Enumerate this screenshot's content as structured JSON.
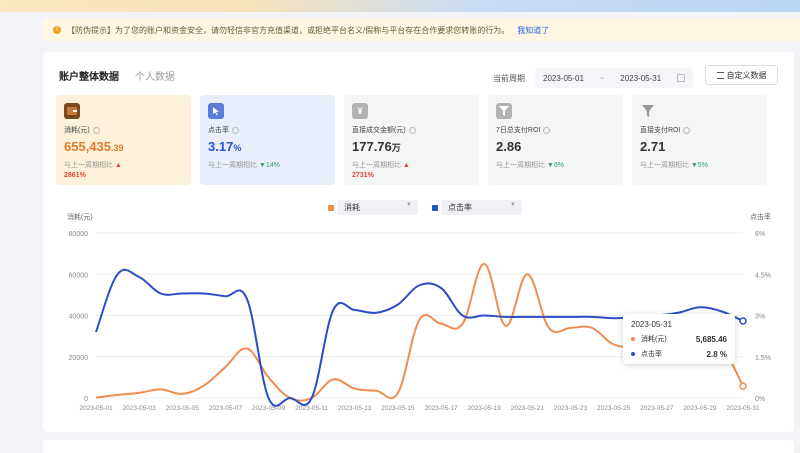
{
  "notice": {
    "text": "【防伪提示】为了您的账户和资金安全，请勿轻信非官方充值渠道，或拒绝平台名义/假称与平台存在合作要求您转账的行为。",
    "link": "我知道了"
  },
  "tabs": [
    {
      "label": "账户整体数据"
    },
    {
      "label": "个人数据"
    }
  ],
  "period": {
    "label": "当前周期",
    "start": "2023-05-01",
    "sep": "~",
    "end": "2023-05-31"
  },
  "custom_button": "自定义数据",
  "kpis": [
    {
      "label": "消耗(元)",
      "value_main": "655,435",
      "value_small": ".39",
      "compare": "与上一周期相比",
      "change": "2861%",
      "dir": "up",
      "icon": "wallet-icon",
      "color": "#e07a2e"
    },
    {
      "label": "点击率",
      "value_main": "3.17",
      "value_small": "%",
      "compare": "与上一周期相比",
      "change": "14%",
      "dir": "down",
      "icon": "click-icon",
      "color": "#2a55c8"
    },
    {
      "label": "直接成交金额(元)",
      "value_main": "177.76",
      "value_small": "万",
      "compare": "与上一周期相比",
      "change": "2731%",
      "dir": "up",
      "icon": "yen-icon",
      "color": "#888888"
    },
    {
      "label": "7日总支付ROI",
      "value_main": "2.86",
      "value_small": "",
      "compare": "与上一周期相比",
      "change": "6%",
      "dir": "down",
      "icon": "funnel-yen-icon",
      "color": "#888888"
    },
    {
      "label": "直接支付ROI",
      "value_main": "2.71",
      "value_small": "",
      "compare": "与上一周期相比",
      "change": "5%",
      "dir": "down",
      "icon": "funnel-icon",
      "color": "#888888"
    }
  ],
  "legend": {
    "s1": "消耗",
    "s2": "点击率"
  },
  "tooltip": {
    "date": "2023-05-31",
    "s1_name": "消耗(元)",
    "s1_value": "5,685.46",
    "s2_name": "点击率",
    "s2_value": "2.8 %"
  },
  "chart_data": {
    "type": "line",
    "ylabel_left": "消耗(元)",
    "ylabel_right": "点击率",
    "left_ticks": [
      "80000",
      "60000",
      "40000",
      "20000",
      "0"
    ],
    "right_ticks": [
      "6%",
      "4.5%",
      "3%",
      "1.5%",
      "0%"
    ],
    "ylim_left": [
      0,
      80000
    ],
    "ylim_right": [
      0,
      6
    ],
    "x_tick_labels": [
      "2023-05-01",
      "2023-05-03",
      "2023-05-05",
      "2023-05-07",
      "2023-05-09",
      "2023-05-11",
      "2023-05-13",
      "2023-05-15",
      "2023-05-17",
      "2023-05-19",
      "2023-05-21",
      "2023-05-23",
      "2023-05-25",
      "2023-05-27",
      "2023-05-29",
      "2023-05-31"
    ],
    "x": [
      "2023-05-01",
      "2023-05-02",
      "2023-05-03",
      "2023-05-04",
      "2023-05-05",
      "2023-05-06",
      "2023-05-07",
      "2023-05-08",
      "2023-05-09",
      "2023-05-10",
      "2023-05-11",
      "2023-05-12",
      "2023-05-13",
      "2023-05-14",
      "2023-05-15",
      "2023-05-16",
      "2023-05-17",
      "2023-05-18",
      "2023-05-19",
      "2023-05-20",
      "2023-05-21",
      "2023-05-22",
      "2023-05-23",
      "2023-05-24",
      "2023-05-25",
      "2023-05-26",
      "2023-05-27",
      "2023-05-28",
      "2023-05-29",
      "2023-05-30",
      "2023-05-31"
    ],
    "series": [
      {
        "name": "消耗",
        "axis": "left",
        "color": "#ef8c4f",
        "values": [
          200,
          1500,
          2500,
          4200,
          2000,
          6000,
          15000,
          24000,
          10000,
          0,
          0,
          9000,
          4500,
          3500,
          2500,
          38000,
          36000,
          36000,
          65000,
          35000,
          60000,
          34000,
          34000,
          34000,
          26000,
          26000,
          36000,
          36000,
          36000,
          26000,
          5700
        ]
      },
      {
        "name": "点击率",
        "axis": "right",
        "color": "#2a4fc4",
        "values": [
          2.4,
          4.5,
          4.4,
          3.8,
          3.8,
          3.8,
          3.7,
          3.6,
          0,
          0,
          0,
          3.2,
          3.2,
          3.1,
          3.4,
          4.1,
          4.0,
          3.0,
          3.0,
          2.95,
          2.95,
          2.95,
          2.95,
          2.95,
          2.9,
          2.95,
          3.0,
          3.1,
          3.3,
          3.15,
          2.8
        ]
      }
    ],
    "grid": true
  },
  "colors": {
    "accent": "#2a66d6",
    "up": "#e0443a",
    "down": "#2fa66a"
  }
}
